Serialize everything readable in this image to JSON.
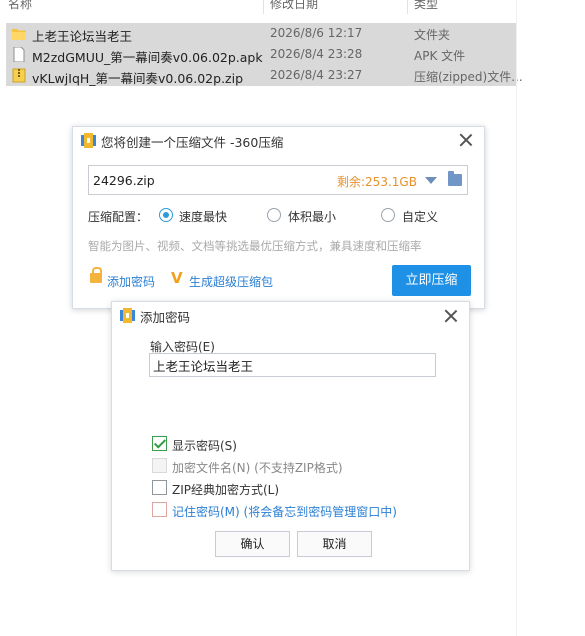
{
  "explorer": {
    "columns": {
      "name": "名称",
      "date": "修改日期",
      "type": "类型"
    },
    "files": [
      {
        "name": "上老王论坛当老王",
        "date": "2026/8/6 12:17",
        "type": "文件夹",
        "icon": "folder-icon"
      },
      {
        "name": "M2zdGMUU_第一幕间奏v0.06.02p.apk",
        "date": "2026/8/4 23:28",
        "type": "APK 文件",
        "icon": "file-icon"
      },
      {
        "name": "vKLwjIqH_第一幕间奏v0.06.02p.zip",
        "date": "2026/8/4 23:27",
        "type": "压缩(zipped)文件...",
        "icon": "zip-file-icon"
      }
    ]
  },
  "compress_dialog": {
    "title": "您将创建一个压缩文件 -360压缩",
    "filename": "24296.zip",
    "remaining": "剩余:253.1GB",
    "config_label": "压缩配置：",
    "options": [
      {
        "label": "速度最快",
        "selected": true
      },
      {
        "label": "体积最小",
        "selected": false
      },
      {
        "label": "自定义",
        "selected": false
      }
    ],
    "hint": "智能为图片、视频、文档等挑选最优压缩方式，兼具速度和压缩率",
    "add_password": "添加密码",
    "super_package": "生成超级压缩包",
    "compress_button": "立即压缩"
  },
  "password_dialog": {
    "title": "添加密码",
    "input_label": "输入密码(E)",
    "password_value": "上老王论坛当老王",
    "checkboxes": [
      {
        "label": "显示密码(S)",
        "checked": true,
        "enabled": true
      },
      {
        "label": "加密文件名(N) (不支持ZIP格式)",
        "checked": false,
        "enabled": false
      },
      {
        "label": "ZIP经典加密方式(L)",
        "checked": false,
        "enabled": true
      },
      {
        "label": "记住密码(M) (将会备忘到密码管理窗口中)",
        "checked": false,
        "enabled": true
      }
    ],
    "ok_button": "确认",
    "cancel_button": "取消"
  },
  "colors": {
    "accent": "#1e90e6",
    "remaining": "#e8912b",
    "link": "#2a7fd4",
    "selected_row": "#d9d9d9"
  }
}
